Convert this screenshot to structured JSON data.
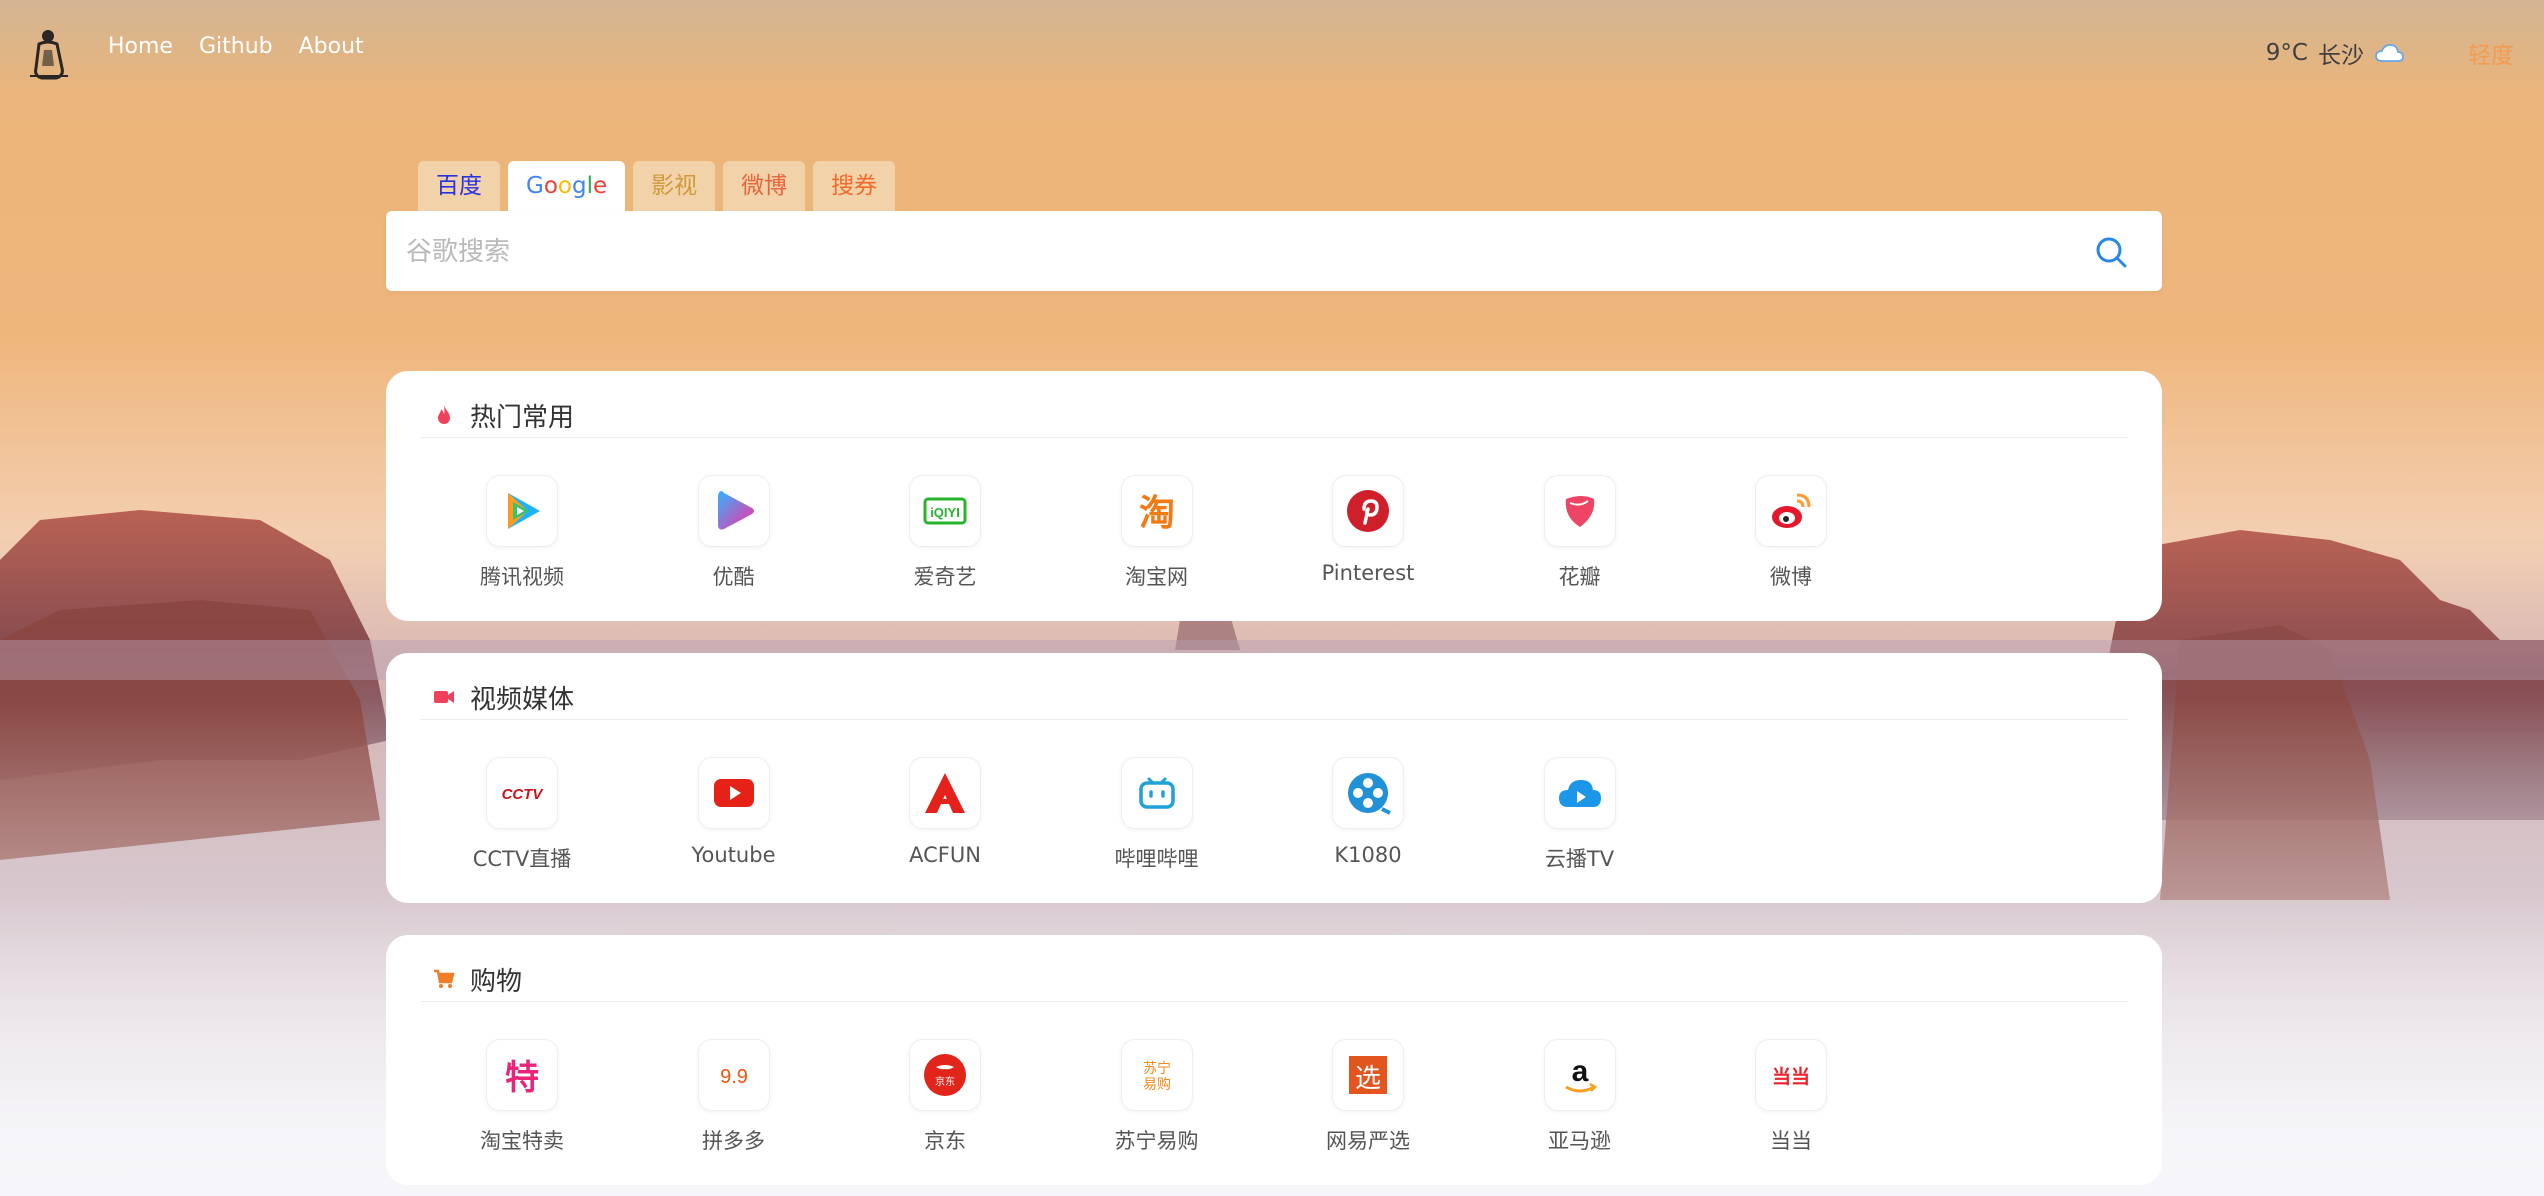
{
  "nav": {
    "links": [
      "Home",
      "Github",
      "About"
    ]
  },
  "weather": {
    "temp": "9°C",
    "city": "长沙",
    "condition_icon": "cloud-icon",
    "air_quality": "轻度"
  },
  "search": {
    "tabs": [
      {
        "label": "百度",
        "color": "#2932e1"
      },
      {
        "label": "Google",
        "color": "#4285f4",
        "active": true
      },
      {
        "label": "影视",
        "color": "#d09a3a"
      },
      {
        "label": "微博",
        "color": "#e8643a"
      },
      {
        "label": "搜券",
        "color": "#f36a2a"
      }
    ],
    "placeholder": "谷歌搜索",
    "button_icon": "search-icon"
  },
  "sections": [
    {
      "title": "热门常用",
      "icon": "fire-icon",
      "icon_color": "#f1405c",
      "sites": [
        {
          "name": "腾讯视频",
          "icon": "tencent-video-icon"
        },
        {
          "name": "优酷",
          "icon": "youku-icon"
        },
        {
          "name": "爱奇艺",
          "icon": "iqiyi-icon"
        },
        {
          "name": "淘宝网",
          "icon": "taobao-icon"
        },
        {
          "name": "Pinterest",
          "icon": "pinterest-icon"
        },
        {
          "name": "花瓣",
          "icon": "huaban-icon"
        },
        {
          "name": "微博",
          "icon": "weibo-icon"
        }
      ]
    },
    {
      "title": "视频媒体",
      "icon": "video-camera-icon",
      "icon_color": "#f1405c",
      "sites": [
        {
          "name": "CCTV直播",
          "icon": "cctv-icon"
        },
        {
          "name": "Youtube",
          "icon": "youtube-icon"
        },
        {
          "name": "ACFUN",
          "icon": "acfun-icon"
        },
        {
          "name": "哔哩哔哩",
          "icon": "bilibili-icon"
        },
        {
          "name": "K1080",
          "icon": "film-reel-icon"
        },
        {
          "name": "云播TV",
          "icon": "cloud-play-icon"
        }
      ]
    },
    {
      "title": "购物",
      "icon": "shopping-cart-icon",
      "icon_color": "#f07d2a",
      "sites": [
        {
          "name": "淘宝特卖",
          "icon": "taobao-temai-icon"
        },
        {
          "name": "拼多多",
          "icon": "pinduoduo-icon"
        },
        {
          "name": "京东",
          "icon": "jd-icon"
        },
        {
          "name": "苏宁易购",
          "icon": "suning-icon"
        },
        {
          "name": "网易严选",
          "icon": "yanxuan-icon"
        },
        {
          "name": "亚马逊",
          "icon": "amazon-icon"
        },
        {
          "name": "当当",
          "icon": "dangdang-icon"
        }
      ]
    }
  ],
  "logo_text": {
    "pinduoduo": "9.9",
    "cctv": "CCTV",
    "iqiyi": "iQIYI",
    "suning_top": "苏宁",
    "suning_bottom": "易购",
    "jd": "京东",
    "taobao_temai": "特",
    "taobao": "淘",
    "yanxuan": "选",
    "dangdang": "当当"
  }
}
